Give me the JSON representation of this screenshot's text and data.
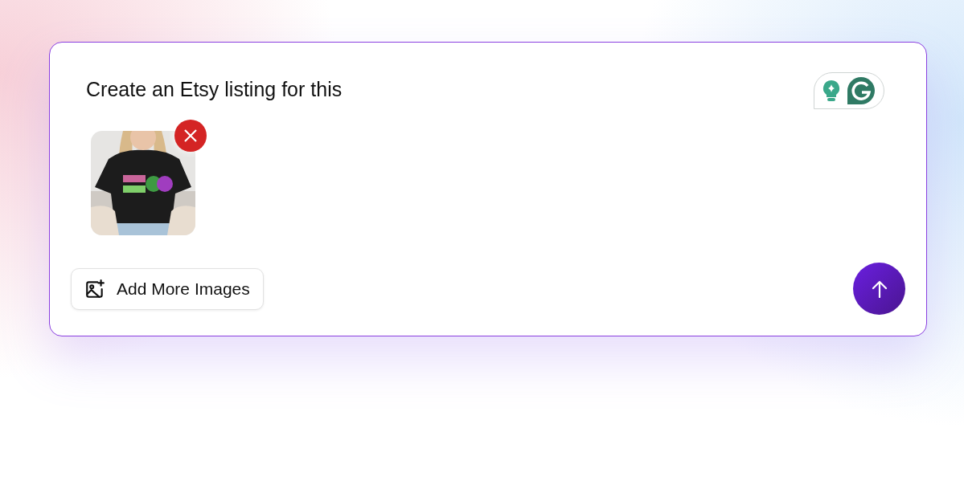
{
  "prompt": {
    "value": "Create an Etsy listing for this"
  },
  "add_button": {
    "label": "Add More Images"
  }
}
